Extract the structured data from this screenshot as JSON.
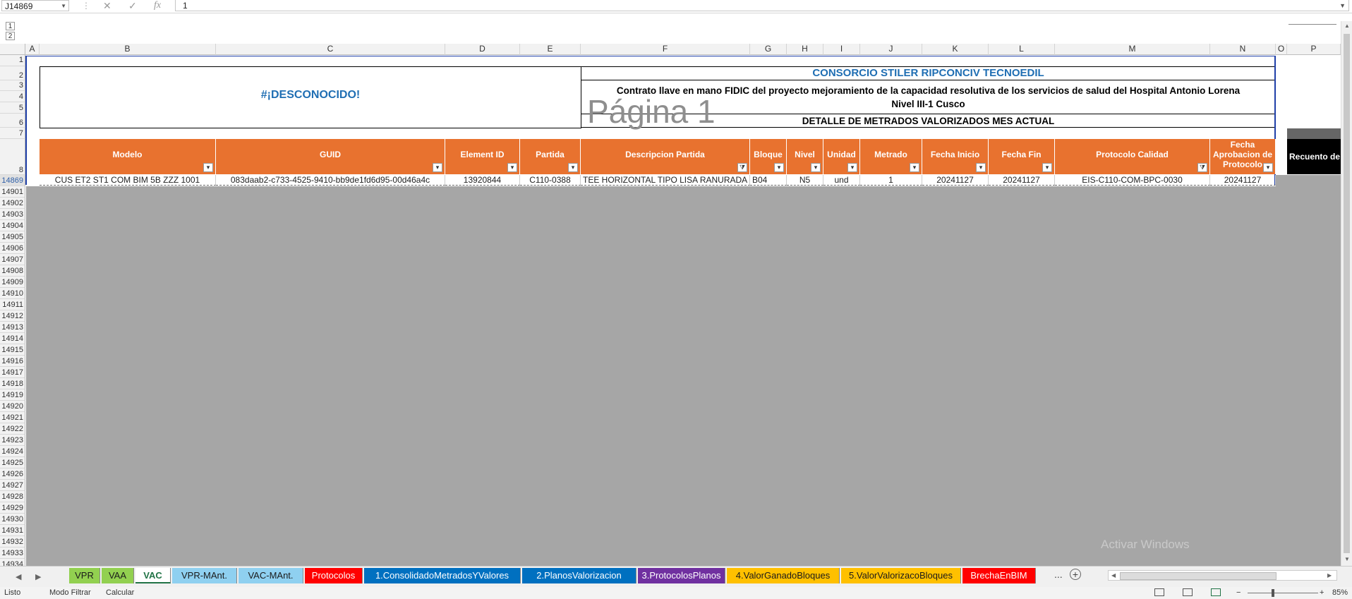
{
  "formula_bar": {
    "name_box": "J14869",
    "fx_symbol": "fx",
    "cancel_symbol": "✕",
    "enter_symbol": "✓",
    "value": "1"
  },
  "outline_levels": [
    "1",
    "2"
  ],
  "columns": [
    "A",
    "B",
    "C",
    "D",
    "E",
    "F",
    "G",
    "H",
    "I",
    "J",
    "K",
    "L",
    "M",
    "N",
    "O",
    "P"
  ],
  "row_numbers_top": [
    "1",
    "2",
    "3",
    "4",
    "5",
    "6",
    "7",
    "8"
  ],
  "row_numbers_bottom": [
    "14869",
    "14901",
    "14902",
    "14903",
    "14904",
    "14905",
    "14906",
    "14907",
    "14908",
    "14909",
    "14910",
    "14911",
    "14912",
    "14913",
    "14914",
    "14915",
    "14916",
    "14917",
    "14918",
    "14919",
    "14920",
    "14921",
    "14922",
    "14923",
    "14924",
    "14925",
    "14926",
    "14927",
    "14928",
    "14929",
    "14930",
    "14931",
    "14932",
    "14933",
    "14934"
  ],
  "header_block": {
    "error_value": "#¡DESCONOCIDO!",
    "company": "CONSORCIO STILER RIPCONCIV TECNOEDIL",
    "contract_line1": "Contrato llave en mano FIDIC del proyecto mejoramiento de la capacidad resolutiva de los servicios de salud del Hospital Antonio Lorena",
    "contract_line2": "Nivel III-1 Cusco",
    "detail": "DETALLE DE METRADOS VALORIZADOS MES ACTUAL",
    "page_watermark": "Página 1"
  },
  "table": {
    "headers": [
      "Modelo",
      "GUID",
      "Element ID",
      "Partida",
      "Descripcion Partida",
      "Bloque",
      "Nivel",
      "Unidad",
      "Metrado",
      "Fecha Inicio",
      "Fecha Fin",
      "Protocolo Calidad",
      "Fecha Aprobacion de Protocolo"
    ],
    "extra_header": "Recuento de",
    "row": [
      "CUS ET2 ST1 COM BIM 5B ZZZ 1001",
      "083daab2-c733-4525-9410-bb9de1fd6d95-00d46a4c",
      "13920844",
      "C110-0388",
      "TEE HORIZONTAL TIPO LISA RANURADA",
      "B04",
      "N5",
      "und",
      "1",
      "20241127",
      "20241127",
      "EIS-C110-COM-BPC-0030",
      "20241127"
    ],
    "filter_arrow": "▾",
    "filter_active": "⧩"
  },
  "sheet_tabs": [
    {
      "label": "VPR",
      "bg": "#92d050",
      "fg": "#1a1a1a"
    },
    {
      "label": "VAA",
      "bg": "#92d050",
      "fg": "#1a1a1a"
    },
    {
      "label": "VAC",
      "bg": "#ffffff",
      "fg": "#217346"
    },
    {
      "label": "VPR-MAnt.",
      "bg": "#8fd0f0",
      "fg": "#1a1a1a"
    },
    {
      "label": "VAC-MAnt.",
      "bg": "#8fd0f0",
      "fg": "#1a1a1a"
    },
    {
      "label": "Protocolos",
      "bg": "#ff0000",
      "fg": "#ffffff"
    },
    {
      "label": "1.ConsolidadoMetradosYValores",
      "bg": "#0070c0",
      "fg": "#ffffff"
    },
    {
      "label": "2.PlanosValorizacion",
      "bg": "#0070c0",
      "fg": "#ffffff"
    },
    {
      "label": "3.ProtocolosPlanos",
      "bg": "#7030a0",
      "fg": "#ffffff"
    },
    {
      "label": "4.ValorGanadoBloques",
      "bg": "#ffc000",
      "fg": "#1a1a1a"
    },
    {
      "label": "5.ValorValorizacoBloques",
      "bg": "#ffc000",
      "fg": "#1a1a1a"
    },
    {
      "label": "BrechaEnBIM",
      "bg": "#ff0000",
      "fg": "#ffffff"
    }
  ],
  "tab_more": "...",
  "tab_add": "+",
  "status_bar": {
    "ready": "Listo",
    "filter_mode": "Modo Filtrar",
    "calculate": "Calcular",
    "zoom_minus": "−",
    "zoom_plus": "+",
    "zoom": "85%"
  },
  "watermark": "Activar Windows",
  "colors": {
    "accent_orange": "#e8722f",
    "title_blue": "#1f6eb3",
    "sheet_gray": "#a6a6a6",
    "excel_green": "#217346"
  }
}
